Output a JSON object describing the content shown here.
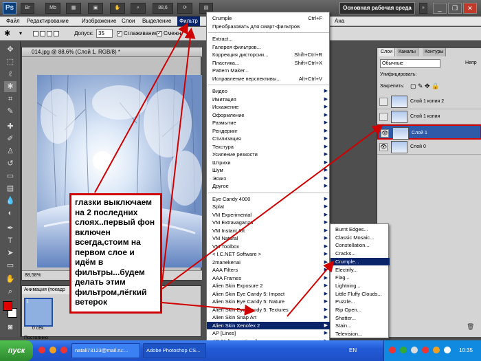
{
  "app": {
    "logo": "Ps",
    "zoom": "88,6",
    "workspace": "Основная рабочая среда",
    "window_buttons": [
      "_",
      "❐",
      "✕"
    ]
  },
  "menubar": [
    "Файл",
    "Редактирование",
    "Изображение",
    "Слои",
    "Выделение",
    "Фильтр",
    "Ана"
  ],
  "options": {
    "tolerance_label": "Допуск:",
    "tolerance_value": "35",
    "antialias": "Сглаживание",
    "contiguous": "Смежн"
  },
  "document": {
    "tab_title": "014.jpg @ 88,6% (Слой 1, RGB/8) *",
    "status_zoom": "88,58%"
  },
  "animation": {
    "title": "Анимация (покадр",
    "frame_number": "1",
    "frame_delay": "0 сек.",
    "loop": "Постоянно"
  },
  "layers": {
    "tabs": [
      "Слои",
      "Каналы",
      "Контуры"
    ],
    "blend_mode": "Обычные",
    "opacity_label": "Непр",
    "unify_label": "Унифицировать:",
    "lock_label": "Закрепить:",
    "items": [
      {
        "name": "Слой 1 копия 2",
        "visible": false,
        "selected": false
      },
      {
        "name": "Слой 1 копия",
        "visible": false,
        "selected": false
      },
      {
        "name": "Слой 1",
        "visible": true,
        "selected": true
      },
      {
        "name": "Слой 0",
        "visible": true,
        "selected": false
      }
    ]
  },
  "filter_menu": {
    "top": [
      {
        "label": "Crumple",
        "shortcut": "Ctrl+F"
      },
      {
        "label": "Преобразовать для смарт-фильтров",
        "shortcut": ""
      }
    ],
    "group2": [
      {
        "label": "Extract...",
        "shortcut": ""
      },
      {
        "label": "Галерея фильтров...",
        "shortcut": ""
      },
      {
        "label": "Коррекция дисторсии...",
        "shortcut": "Shift+Ctrl+R"
      },
      {
        "label": "Пластика...",
        "shortcut": "Shift+Ctrl+X"
      },
      {
        "label": "Pattern Maker...",
        "shortcut": ""
      },
      {
        "label": "Исправление перспективы...",
        "shortcut": "Alt+Ctrl+V"
      }
    ],
    "group3": [
      "Видео",
      "Имитация",
      "Искажение",
      "Оформление",
      "Размытие",
      "Рендеринг",
      "Стилизация",
      "Текстура",
      "Усиление резкости",
      "Штрихи",
      "Шум",
      "Эскиз",
      "Другое"
    ],
    "group4": [
      "Eye Candy 4000",
      "Splat",
      "VM Experimental",
      "VM Extravaganza",
      "VM Instant Art",
      "VM Natural",
      "VM Toolbox",
      "< I.C.NET Software >",
      "2manekenai",
      "AAA Filters",
      "AAA Frames",
      "Alien Skin Exposure 2",
      "Alien Skin Eye Candy 5: Impact",
      "Alien Skin Eye Candy 5: Nature",
      "Alien Skin Eye Candy 5: Textures",
      "Alien Skin Snap Art",
      "Alien Skin Xenofex 2",
      "AP [Lines]",
      "AP 01 [Innovations]"
    ],
    "highlighted": "Alien Skin Xenofex 2",
    "more": "▼"
  },
  "submenu": {
    "items": [
      "Burnt Edges...",
      "Classic Mosaic...",
      "Constellation...",
      "Cracks...",
      "Crumple...",
      "Electrify...",
      "Flag...",
      "Lightning...",
      "Little Fluffy Clouds...",
      "Puzzle...",
      "Rip Open...",
      "Shatter...",
      "Stain...",
      "Television..."
    ],
    "highlighted": "Crumple..."
  },
  "note": {
    "text": "глазки выключаем на 2 последних слоях..первый фон включен всегда,стоим на первом слое и идём в фильтры...будем делать этим фильтром,лёгкий ветерок"
  },
  "taskbar": {
    "start": "пуск",
    "buttons": [
      "natali73123@mail.ru:...",
      "Adobe Photoshop CS..."
    ],
    "lang": "EN",
    "clock": "10:35"
  },
  "colors": {
    "annotation_border": "#d00000",
    "arrow": "#d00000",
    "menu_highlight": "#0a246a",
    "layer_selected": "#2f5aa8",
    "foreground": "#e00000"
  }
}
